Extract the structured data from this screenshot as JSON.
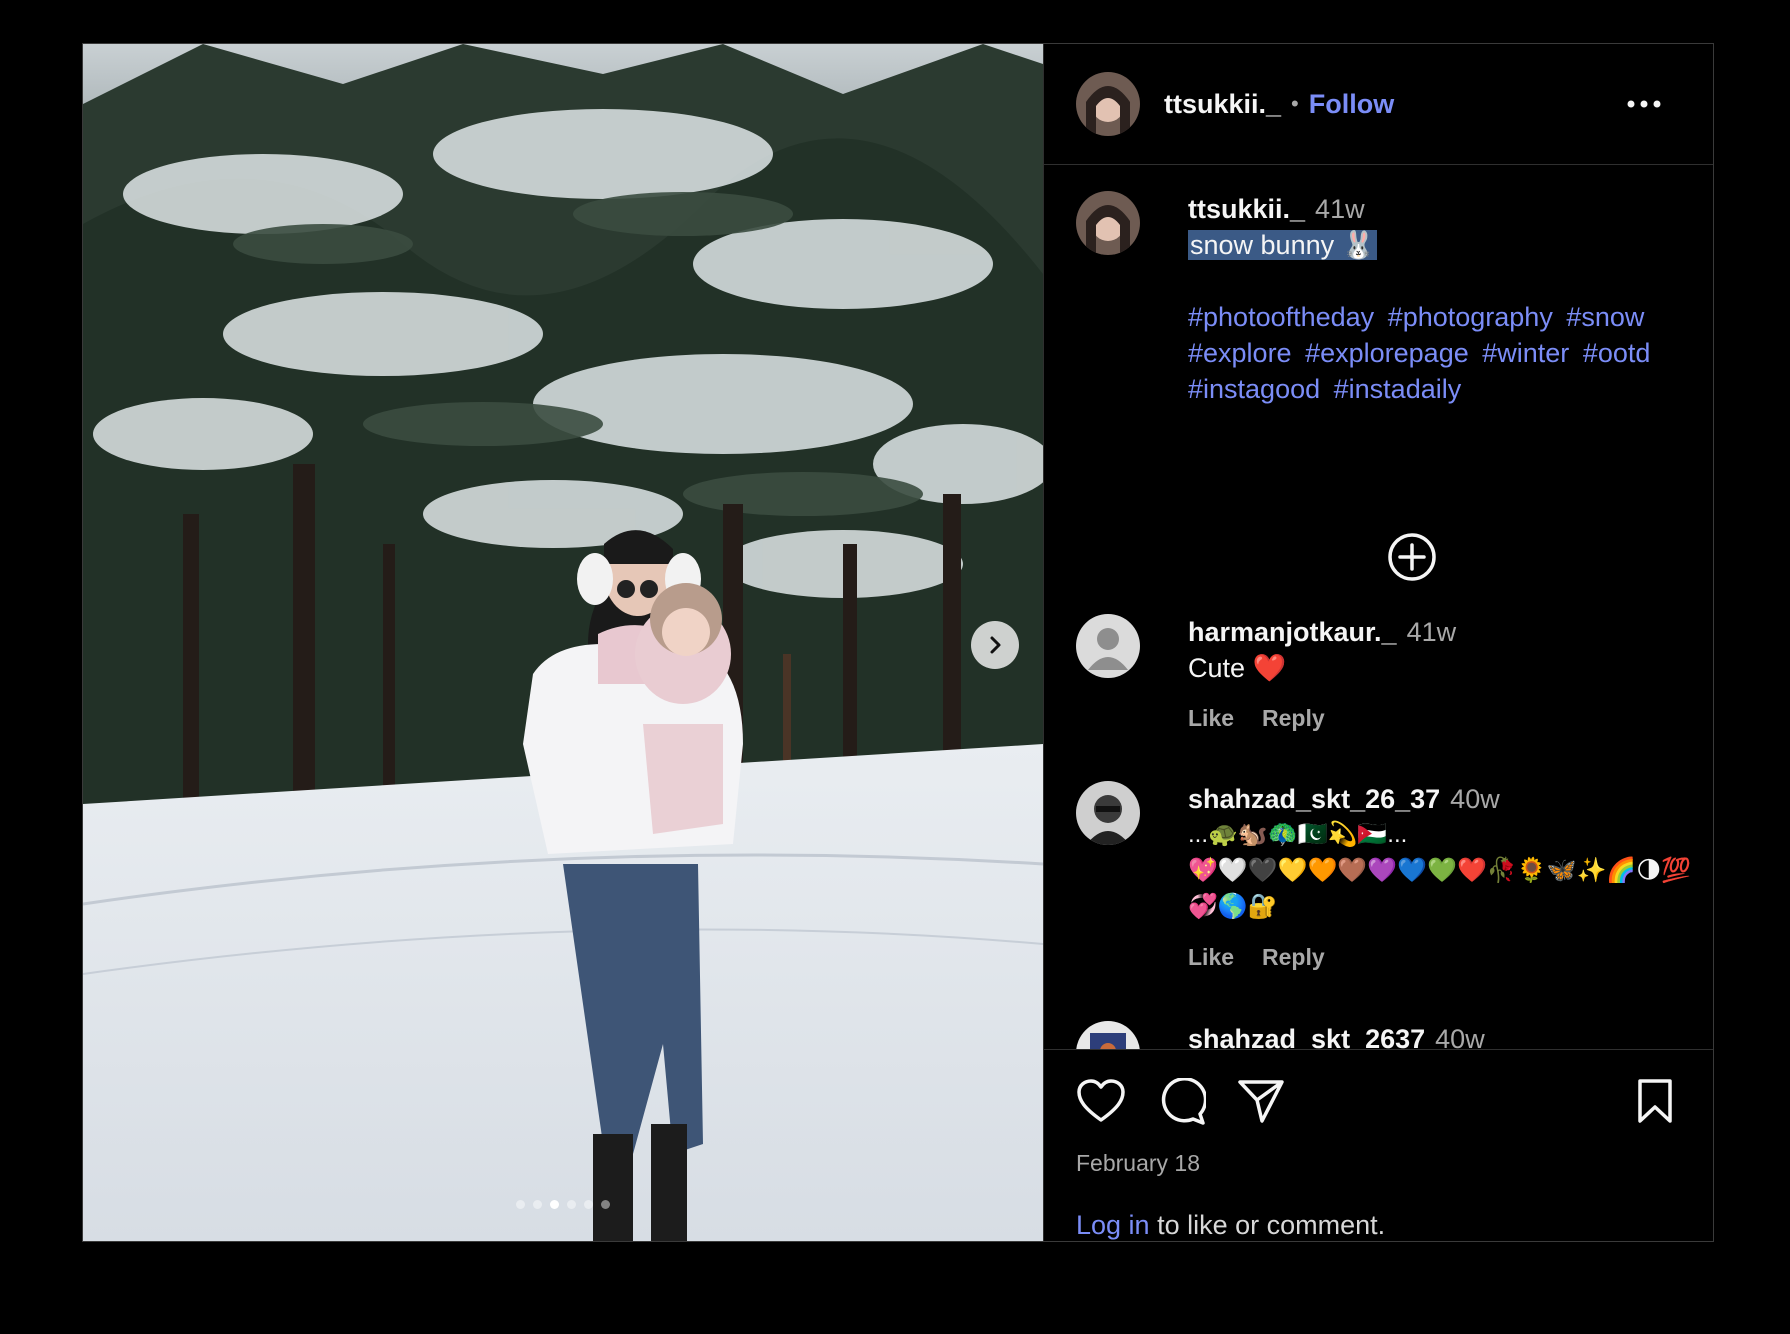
{
  "header": {
    "username": "ttsukkii._",
    "separator": "•",
    "follow_label": "Follow",
    "more_icon": "more-horizontal-icon"
  },
  "caption": {
    "username": "ttsukkii._",
    "time": "41w",
    "text": "snow bunny 🐰",
    "hashtags": [
      "#photooftheday",
      "#photography",
      "#snow",
      "#explore",
      "#explorepage",
      "#winter",
      "#ootd",
      "#instagood",
      "#instadaily"
    ]
  },
  "load_more_icon": "plus-circle-icon",
  "comments": [
    {
      "username": "harmanjotkaur._",
      "time": "41w",
      "text": "Cute ❤️",
      "like_label": "Like",
      "reply_label": "Reply"
    },
    {
      "username": "shahzad_skt_26_37",
      "time": "40w",
      "text": "...🐢🐿️🦚🇵🇰💫🇯🇴...\n💖🤍🖤💛🧡🤎💜💙💚❤️🥀🌻🦋✨🌈🌗💯💞🌎🔐",
      "like_label": "Like",
      "reply_label": "Reply"
    },
    {
      "username": "shahzad_skt_2637",
      "time": "40w"
    }
  ],
  "actions": {
    "like_icon": "heart-icon",
    "comment_icon": "comment-icon",
    "share_icon": "send-icon",
    "save_icon": "bookmark-icon"
  },
  "date": "February 18",
  "login_prompt": {
    "link": "Log in",
    "rest": " to like or comment."
  },
  "media": {
    "carousel_count": 6,
    "carousel_active_index": 2,
    "next_icon": "chevron-right-icon"
  }
}
